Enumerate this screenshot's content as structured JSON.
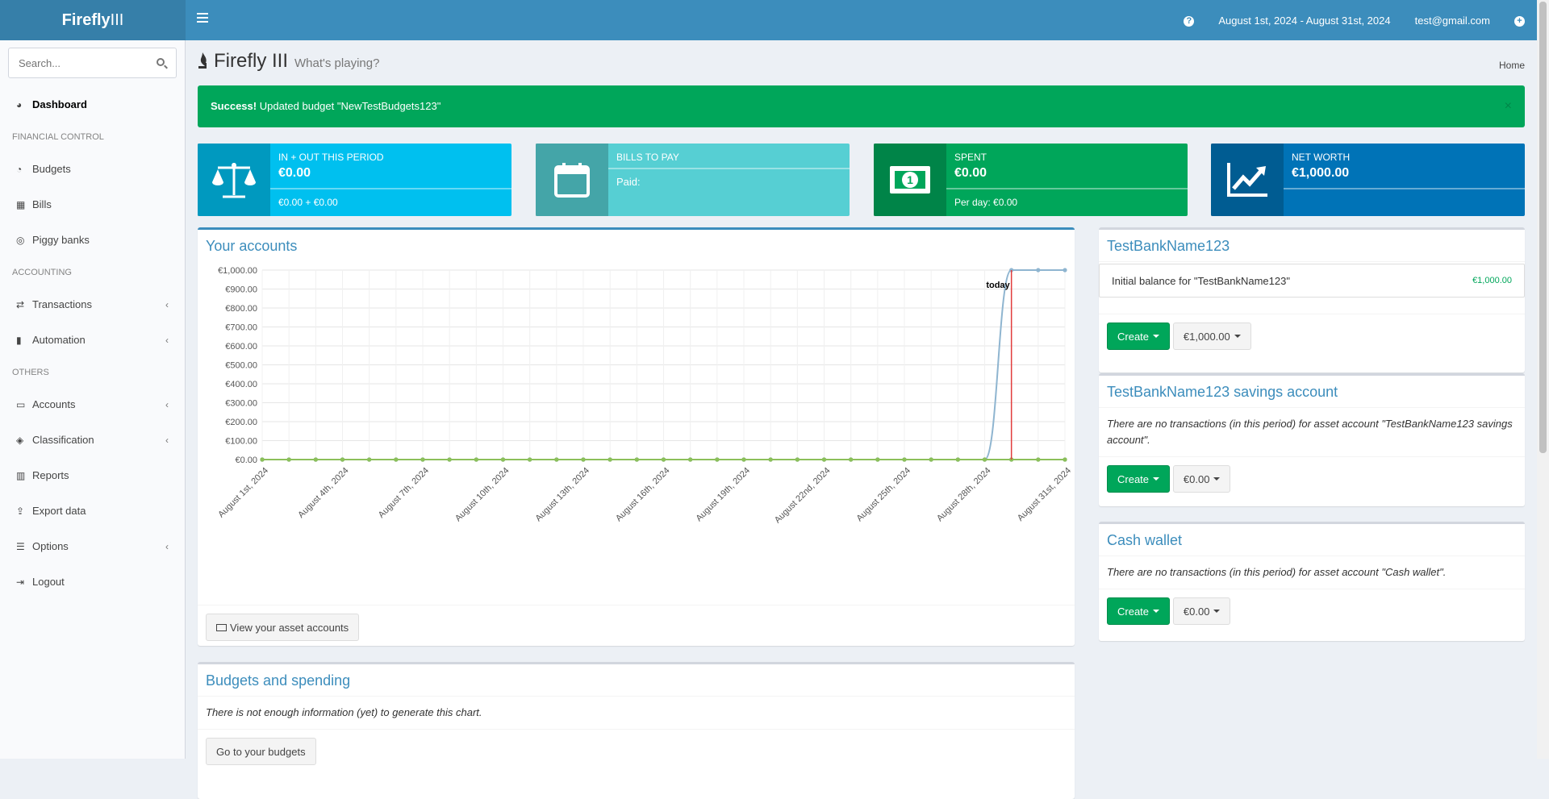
{
  "app": {
    "brand_bold": "Firefly",
    "brand_thin": "III"
  },
  "topbar": {
    "period": "August 1st, 2024 - August 31st, 2024",
    "user": "test@gmail.com",
    "help_icon": "question-circle-icon",
    "add_icon": "plus-circle-icon"
  },
  "sidebar": {
    "search_placeholder": "Search...",
    "dashboard": "Dashboard",
    "financial_header": "FINANCIAL CONTROL",
    "budgets": "Budgets",
    "bills": "Bills",
    "piggy": "Piggy banks",
    "accounting_header": "ACCOUNTING",
    "transactions": "Transactions",
    "automation": "Automation",
    "others_header": "OTHERS",
    "accounts": "Accounts",
    "classification": "Classification",
    "reports": "Reports",
    "export": "Export data",
    "options": "Options",
    "logout": "Logout"
  },
  "header": {
    "title": "Firefly III",
    "subtitle": "What's playing?",
    "breadcrumb": "Home"
  },
  "alert": {
    "strong": "Success!",
    "message": "Updated budget \"NewTestBudgets123\"",
    "close": "×"
  },
  "info_boxes": {
    "inout": {
      "title": "IN + OUT THIS PERIOD",
      "value": "€0.00",
      "desc": "€0.00 + €0.00",
      "color": "#00c0ef"
    },
    "bills": {
      "title": "BILLS TO PAY",
      "value": "Paid:",
      "color": "#56cfd3"
    },
    "spent": {
      "title": "SPENT",
      "value": "€0.00",
      "desc": "Per day: €0.00",
      "color": "#00a65a"
    },
    "networth": {
      "title": "NET WORTH",
      "value": "€1,000.00",
      "color": "#0073b7"
    }
  },
  "accounts_box": {
    "title": "Your accounts",
    "button": "View your asset accounts"
  },
  "chart_data": {
    "type": "line",
    "x_labels": [
      "August 1st, 2024",
      "August 4th, 2024",
      "August 7th, 2024",
      "August 10th, 2024",
      "August 13th, 2024",
      "August 16th, 2024",
      "August 19th, 2024",
      "August 22nd, 2024",
      "August 25th, 2024",
      "August 28th, 2024",
      "August 31st, 2024"
    ],
    "y_labels": [
      "€1,000.00",
      "€900.00",
      "€800.00",
      "€700.00",
      "€600.00",
      "€500.00",
      "€400.00",
      "€300.00",
      "€200.00",
      "€100.00",
      "€0.00"
    ],
    "ylim": [
      0,
      1000
    ],
    "days": 31,
    "today_day": 29,
    "today_label": "today",
    "series": [
      {
        "color": "#8fb5d0",
        "values": [
          0,
          0,
          0,
          0,
          0,
          0,
          0,
          0,
          0,
          0,
          0,
          0,
          0,
          0,
          0,
          0,
          0,
          0,
          0,
          0,
          0,
          0,
          0,
          0,
          0,
          0,
          0,
          0,
          1000,
          1000,
          1000
        ]
      },
      {
        "color": "#4b9e7e",
        "values": [
          0,
          0,
          0,
          0,
          0,
          0,
          0,
          0,
          0,
          0,
          0,
          0,
          0,
          0,
          0,
          0,
          0,
          0,
          0,
          0,
          0,
          0,
          0,
          0,
          0,
          0,
          0,
          0,
          0,
          0,
          0
        ]
      },
      {
        "color": "#8cbf5a",
        "values": [
          0,
          0,
          0,
          0,
          0,
          0,
          0,
          0,
          0,
          0,
          0,
          0,
          0,
          0,
          0,
          0,
          0,
          0,
          0,
          0,
          0,
          0,
          0,
          0,
          0,
          0,
          0,
          0,
          0,
          0,
          0
        ]
      }
    ],
    "today_line_color": "#e23c3c"
  },
  "budgets_box": {
    "title": "Budgets and spending",
    "empty": "There is not enough information (yet) to generate this chart.",
    "button": "Go to your budgets"
  },
  "acct1": {
    "title": "TestBankName123",
    "row_label": "Initial balance for \"TestBankName123\"",
    "row_amount": "€1,000.00",
    "create": "Create",
    "balance": "€1,000.00"
  },
  "acct2": {
    "title": "TestBankName123 savings account",
    "empty": "There are no transactions (in this period) for asset account \"TestBankName123 savings account\".",
    "create": "Create",
    "balance": "€0.00"
  },
  "acct3": {
    "title": "Cash wallet",
    "empty": "There are no transactions (in this period) for asset account \"Cash wallet\".",
    "create": "Create",
    "balance": "€0.00"
  }
}
